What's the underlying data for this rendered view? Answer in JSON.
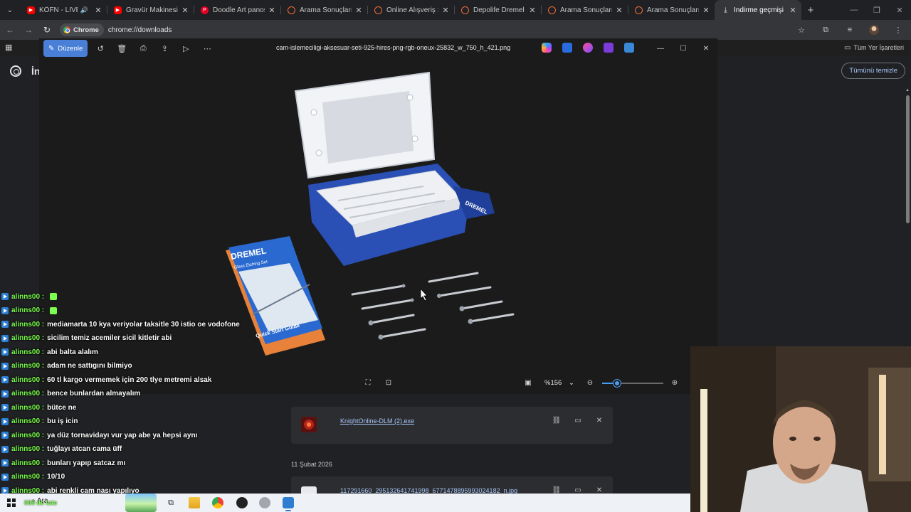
{
  "browser": {
    "tabs": [
      {
        "title": "KÖFN - LIVE SET",
        "favicon": "youtube-icon",
        "audio": true,
        "active": false
      },
      {
        "title": "Gravür Makinesi İçin",
        "favicon": "youtube-icon",
        "audio": false,
        "active": false
      },
      {
        "title": "Doodle Art panosund",
        "favicon": "pinterest-icon",
        "audio": false,
        "active": false
      },
      {
        "title": "Arama Sonuçları - Tre",
        "favicon": "trendyol-icon",
        "audio": false,
        "active": false
      },
      {
        "title": "Online Alışveriş Sitesi",
        "favicon": "trendyol-icon",
        "audio": false,
        "active": false
      },
      {
        "title": "Depolife Dremel Pro",
        "favicon": "trendyol-icon",
        "audio": false,
        "active": false
      },
      {
        "title": "Arama Sonuçları - Tre",
        "favicon": "trendyol-icon",
        "audio": false,
        "active": false
      },
      {
        "title": "Arama Sonuçları - Tre",
        "favicon": "trendyol-icon",
        "audio": false,
        "active": false
      },
      {
        "title": "İndirme geçmişi",
        "favicon": "download-icon",
        "audio": false,
        "active": true
      }
    ],
    "omnibox": {
      "chip_label": "Chrome",
      "url": "chrome://downloads"
    },
    "bookmarks_all_label": "Tüm Yer İşaretleri"
  },
  "downloads": {
    "heading": "İn",
    "clear_all_label": "Tümünü temizle",
    "items": [
      {
        "name": "KnightOnline-DLM (2).exe"
      },
      {
        "name": "117291660_295132641741998_6771478895993024182_n.jpg"
      }
    ],
    "date_group": "11 Şubat 2026"
  },
  "viewer": {
    "edit_label": "Düzenle",
    "file_title": "cam-islemeciligi-aksesuar-seti-925-hires-png-rgb-oneux-25832_w_750_h_421.png",
    "zoom_label": "%156",
    "zoom_fraction": 0.24
  },
  "photo": {
    "box_text": "DREMEL",
    "guide_brand": "DREMEL",
    "guide_product": "Glass Etching Set",
    "guide_title": "Quick Start Guide"
  },
  "chat": {
    "messages": [
      {
        "user": "alinns00 :",
        "text": "",
        "emote": true
      },
      {
        "user": "alinns00 :",
        "text": "",
        "emote": true
      },
      {
        "user": "alinns00 :",
        "text": "mediamarta 10 kya veriyolar taksitle 30 istio oe vodofone",
        "emote": false
      },
      {
        "user": "alinns00 :",
        "text": "sicilim temiz acemiler sicil kitletir abi",
        "emote": false
      },
      {
        "user": "alinns00 :",
        "text": "abi balta alalım",
        "emote": false
      },
      {
        "user": "alinns00 :",
        "text": "adam ne sattıgını bilmiyo",
        "emote": false
      },
      {
        "user": "alinns00 :",
        "text": "60 tl kargo vermemek için 200 tlye metremi alsak",
        "emote": false
      },
      {
        "user": "alinns00 :",
        "text": "bence bunlardan almayalım",
        "emote": false
      },
      {
        "user": "alinns00 :",
        "text": "bütce ne",
        "emote": false
      },
      {
        "user": "alinns00 :",
        "text": "bu iş icin",
        "emote": false
      },
      {
        "user": "alinns00 :",
        "text": "ya düz tornavidayı vur yap abe ya hepsi aynı",
        "emote": false
      },
      {
        "user": "alinns00 :",
        "text": "tuğlayı atcan cama üff",
        "emote": false
      },
      {
        "user": "alinns00 :",
        "text": "bunları yapıp satcaz mı",
        "emote": false
      },
      {
        "user": "alinns00 :",
        "text": "10/10",
        "emote": false
      },
      {
        "user": "alinns00 :",
        "text": "abi renkli cam nası yapılıyo",
        "emote": false
      }
    ]
  },
  "taskbar": {
    "search_label": "Ara",
    "overlay_text": "000 de iste"
  },
  "colors": {
    "accent": "#4a7fd8",
    "link": "#a8c7fa",
    "chat_user": "#7cff4e",
    "dremel_blue": "#2a4fb5"
  }
}
